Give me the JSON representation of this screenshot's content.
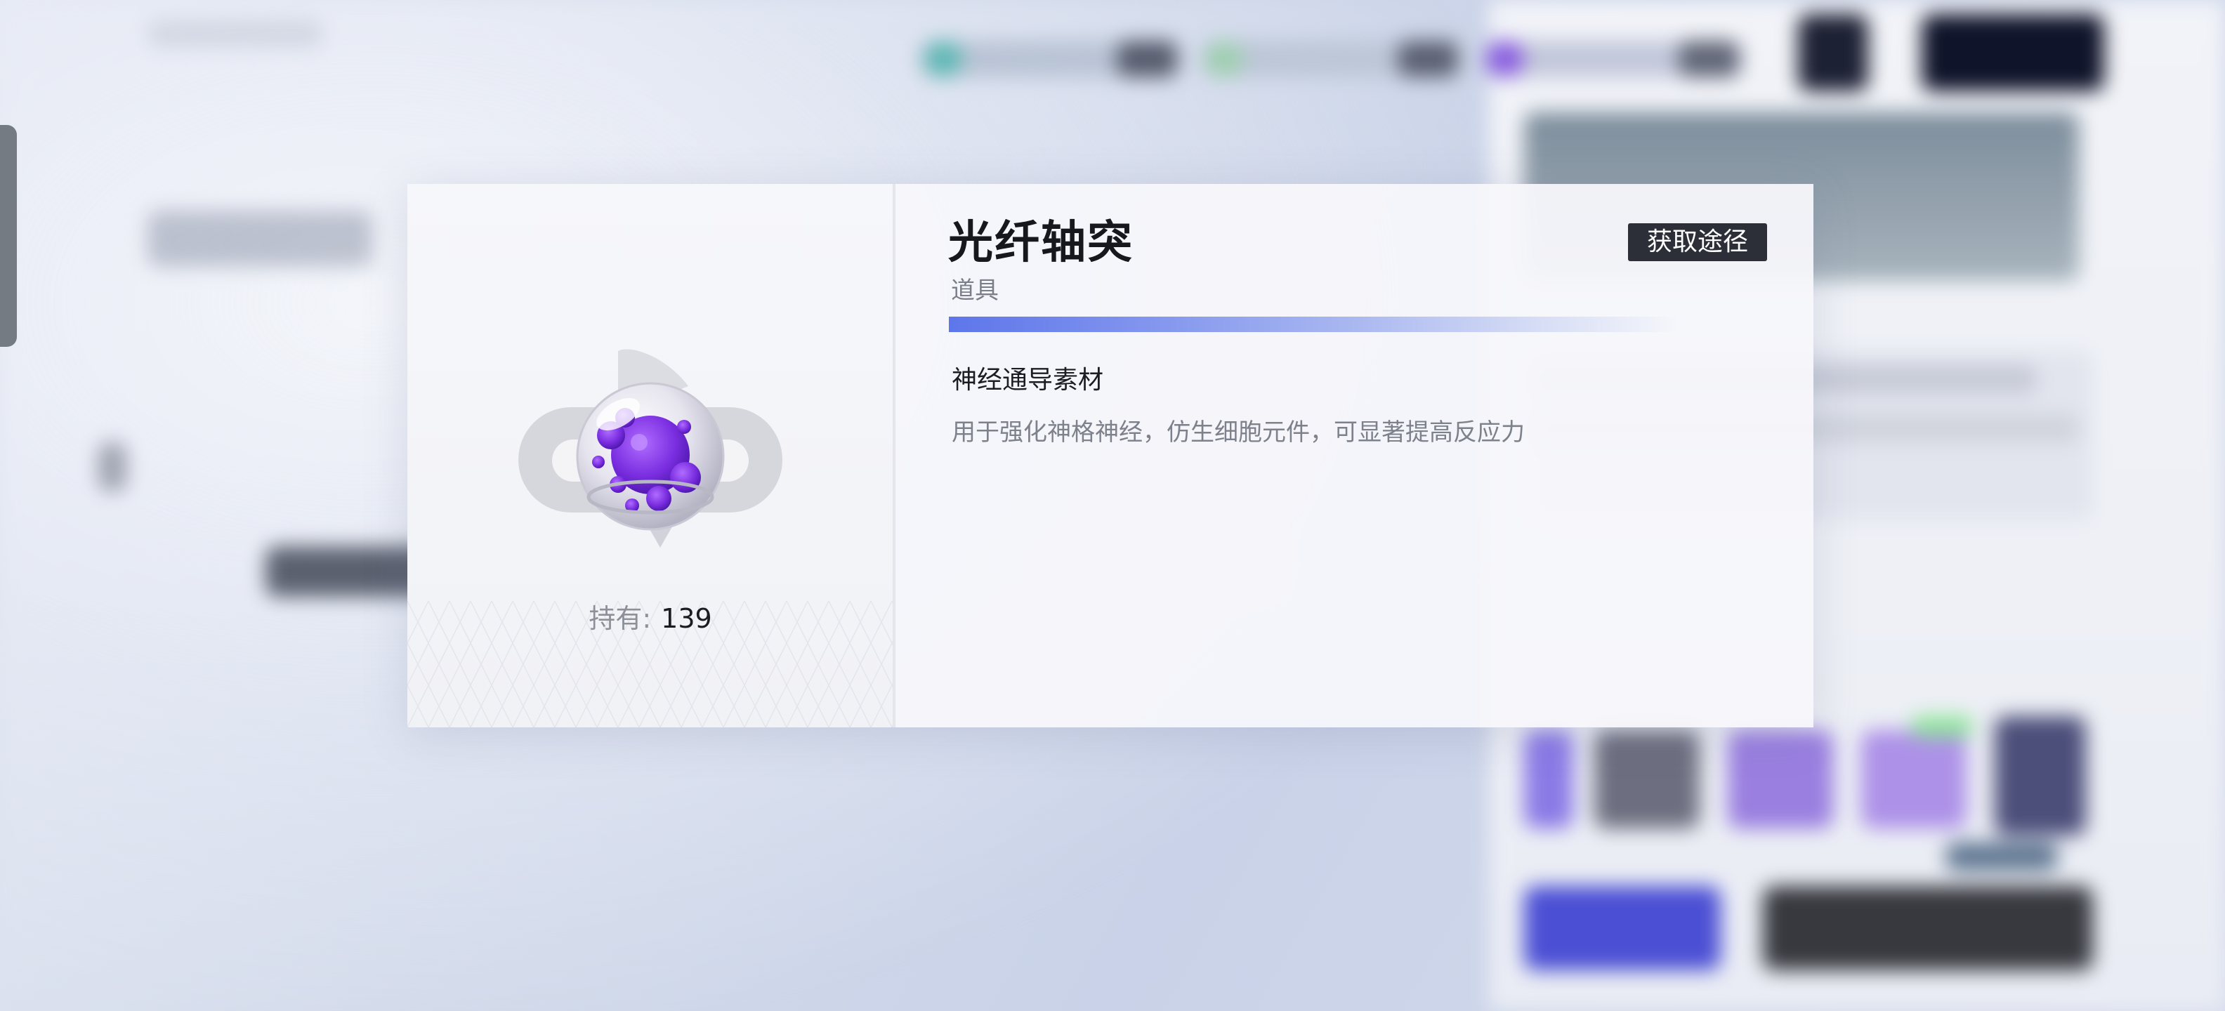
{
  "item": {
    "name": "光纤轴突",
    "type": "道具",
    "category": "神经通导素材",
    "description": "用于强化神格神经，仿生细胞元件，可显著提高反应力",
    "hold_label": "持有:",
    "hold_count": "139",
    "source_button": "获取途径",
    "icon": "purple-orb-material-icon"
  },
  "colors": {
    "accent": "#5d76ea",
    "button_bg": "#2d2f38",
    "orb_purple": "#7a2ee0",
    "side_tab": "#757b83"
  }
}
